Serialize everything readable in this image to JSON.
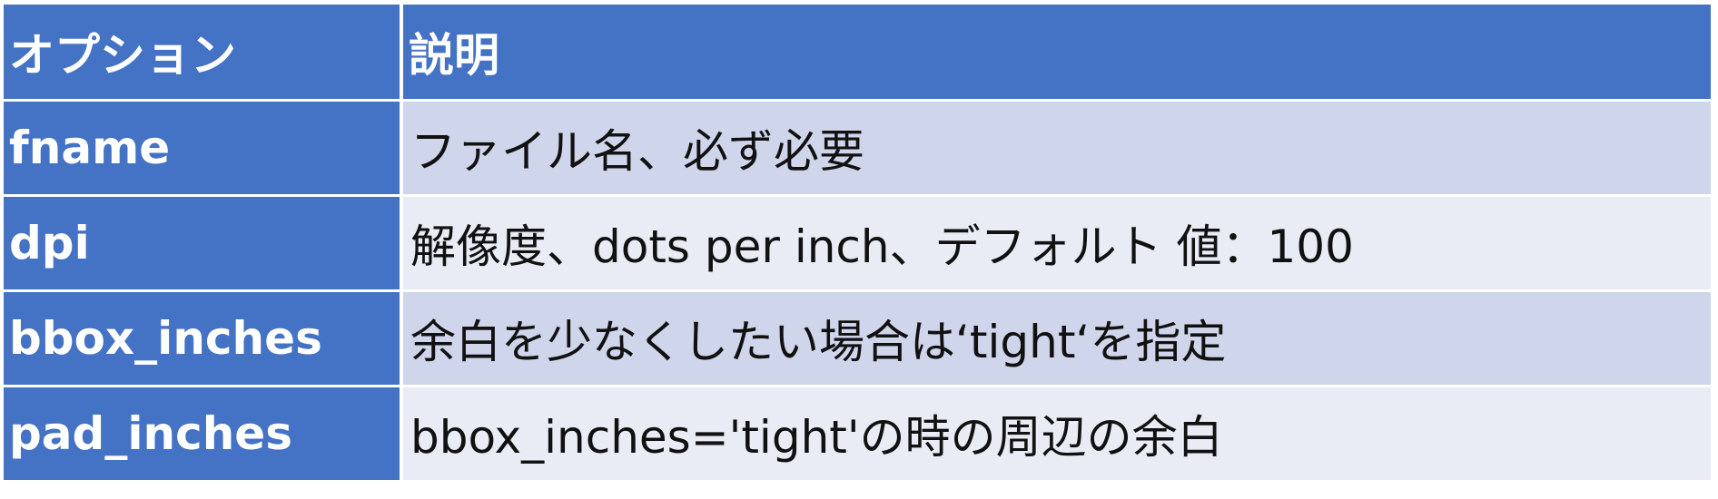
{
  "table": {
    "headers": [
      "オプション",
      "説明"
    ],
    "rows": [
      {
        "option": "fname",
        "description": "ファイル名、必ず必要"
      },
      {
        "option": "dpi",
        "description": "解像度、dots per inch、デフォルト 値：100"
      },
      {
        "option": "bbox_inches",
        "description": "余白を少なくしたい場合は‘tight‘を指定"
      },
      {
        "option": "pad_inches",
        "description": "bbox_inches='tight'の時の周辺の余白"
      }
    ]
  },
  "colors": {
    "header_bg": "#4472c4",
    "row_dark": "#cfd5ea",
    "row_light": "#e9ebf5"
  }
}
